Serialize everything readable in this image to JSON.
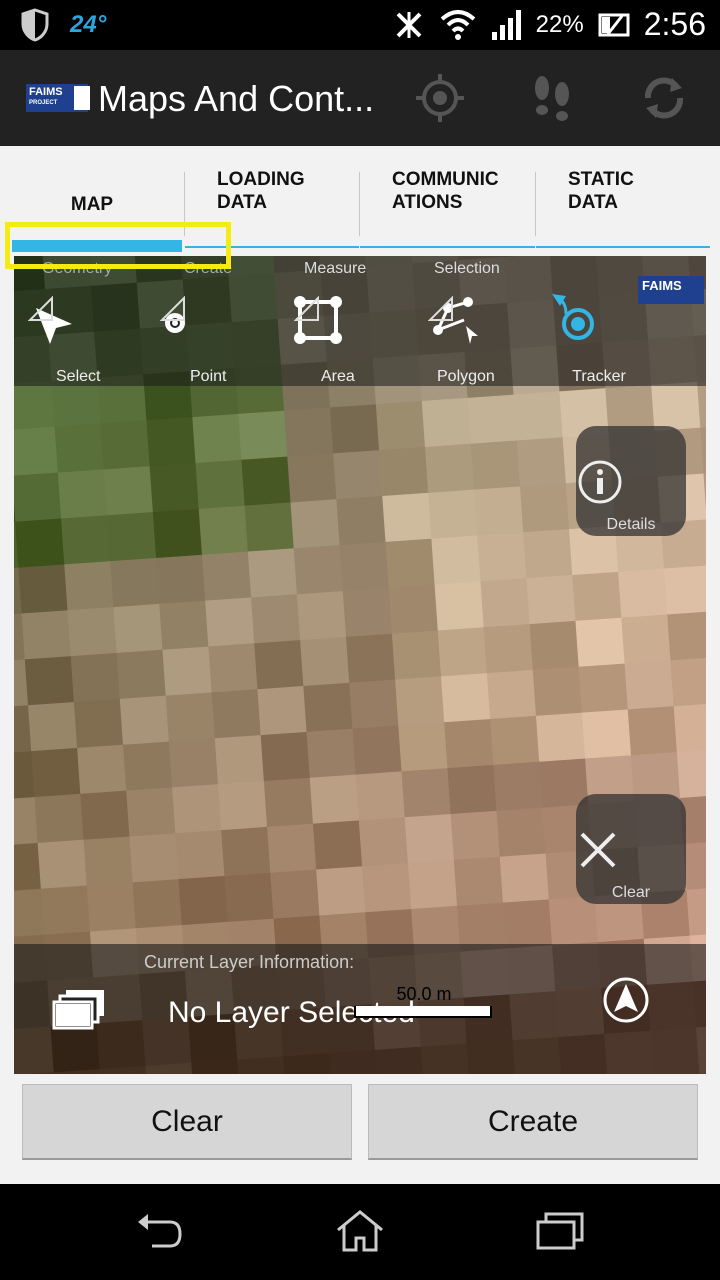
{
  "status_bar": {
    "temperature": "24°",
    "battery": "22%",
    "time": "2:56"
  },
  "action_bar": {
    "logo_text": "FAIMS",
    "logo_sub": "PROJECT",
    "title": "Maps And Cont..."
  },
  "tabs": [
    {
      "label": "MAP",
      "active": true
    },
    {
      "label": "LOADING DATA",
      "active": false
    },
    {
      "label": "COMMUNIC ATIONS",
      "active": false
    },
    {
      "label": "STATIC DATA",
      "active": false
    }
  ],
  "map": {
    "group_labels": [
      "Geometry",
      "Create",
      "Measure",
      "Selection"
    ],
    "tools": [
      {
        "label": "Select",
        "icon": "select-arrow-icon"
      },
      {
        "label": "Point",
        "icon": "point-icon"
      },
      {
        "label": "Area",
        "icon": "area-icon"
      },
      {
        "label": "Polygon",
        "icon": "polygon-icon"
      },
      {
        "label": "Tracker",
        "icon": "tracker-icon"
      }
    ],
    "details_label": "Details",
    "clear_label": "Clear",
    "layer_info_label": "Current Layer Information:",
    "layer_name": "No Layer Selected",
    "scale_label": "50.0 m",
    "watermark": "FAIMS"
  },
  "buttons": {
    "clear": "Clear",
    "create": "Create"
  },
  "colors": {
    "accent": "#33b5e5",
    "highlight": "#f5ea14",
    "action_bar": "#222222"
  }
}
